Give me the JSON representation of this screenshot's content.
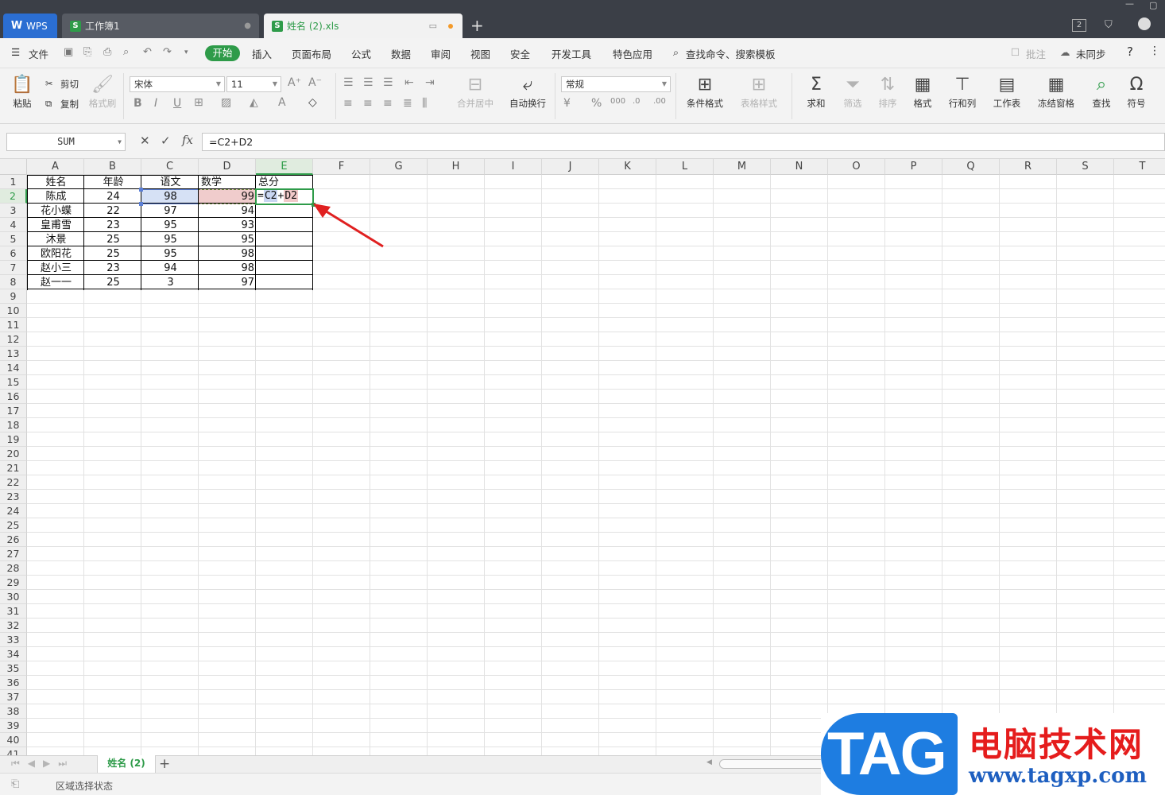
{
  "titlebar": {
    "tabs": [
      {
        "label": "WPS"
      },
      {
        "label": "工作簿1"
      },
      {
        "label": "姓名 (2).xls"
      }
    ],
    "badge_count": "2"
  },
  "menu": {
    "file": "文件",
    "active_tab": "开始",
    "tabs": [
      "插入",
      "页面布局",
      "公式",
      "数据",
      "审阅",
      "视图",
      "安全",
      "开发工具",
      "特色应用"
    ],
    "search": "查找命令、搜索模板",
    "comment": "批注",
    "sync": "未同步",
    "help": "?"
  },
  "ribbon": {
    "paste": "粘贴",
    "cut": "剪切",
    "copy": "复制",
    "format_painter": "格式刷",
    "font_name": "宋体",
    "font_size": "11",
    "merge_center": "合并居中",
    "wrap_text": "自动换行",
    "number_format": "常规",
    "conditional_format": "条件格式",
    "table_style": "表格样式",
    "sum": "求和",
    "filter": "筛选",
    "sort": "排序",
    "format": "格式",
    "rows_cols": "行和列",
    "worksheet": "工作表",
    "freeze": "冻结窗格",
    "find": "查找",
    "symbol": "符号"
  },
  "formula_bar": {
    "name_box": "SUM",
    "fx": "fx",
    "formula": "=C2+D2"
  },
  "grid": {
    "columns": [
      "A",
      "B",
      "C",
      "D",
      "E",
      "F",
      "G",
      "H",
      "I",
      "J",
      "K",
      "L",
      "M",
      "N",
      "O",
      "P",
      "Q",
      "R",
      "S",
      "T"
    ],
    "rows": [
      "1",
      "2",
      "3",
      "4",
      "5",
      "6",
      "7",
      "8",
      "9",
      "10",
      "11",
      "12",
      "13",
      "14",
      "15",
      "16",
      "17",
      "18",
      "19",
      "20",
      "21",
      "22",
      "23",
      "24",
      "25",
      "26",
      "27",
      "28",
      "29",
      "30",
      "31",
      "32",
      "33",
      "34",
      "35",
      "36",
      "37",
      "38",
      "39",
      "40",
      "41"
    ],
    "headers": [
      "姓名",
      "年龄",
      "语文",
      "数学",
      "总分"
    ],
    "data": [
      [
        "陈成",
        "24",
        "98",
        "99"
      ],
      [
        "花小蝶",
        "22",
        "97",
        "94"
      ],
      [
        "皇甫雪",
        "23",
        "95",
        "93"
      ],
      [
        "沐景",
        "25",
        "95",
        "95"
      ],
      [
        "欧阳花",
        "25",
        "95",
        "98"
      ],
      [
        "赵小三",
        "23",
        "94",
        "98"
      ],
      [
        "赵一一",
        "25",
        "3",
        "97"
      ]
    ],
    "editing_cell": {
      "eq": "=",
      "ref1": "C2",
      "op": "+",
      "ref2": "D2"
    }
  },
  "sheets": {
    "active": "姓名 (2)",
    "add": "+"
  },
  "status": {
    "text": "区域选择状态"
  },
  "watermark": {
    "tag": "TAG",
    "title": "电脑技术网",
    "url": "www.tagxp.com"
  },
  "colors": {
    "accent": "#2e9b49",
    "ref_c2": "#5b7fd6",
    "ref_d2": "#f0cccc",
    "arrow": "#e02020"
  }
}
